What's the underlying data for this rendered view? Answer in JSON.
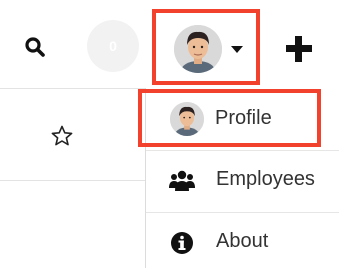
{
  "header": {
    "search_icon": "search-icon",
    "notification_count": "0",
    "user_menu_icon": "user-avatar",
    "caret_icon": "caret-down-icon",
    "create_icon": "plus-icon"
  },
  "list": {
    "favorite_icon": "star-icon"
  },
  "user_menu": {
    "items": [
      {
        "label": "Profile",
        "icon": "user-avatar",
        "highlighted": true
      },
      {
        "label": "Employees",
        "icon": "users-icon"
      },
      {
        "label": "About",
        "icon": "info-icon"
      }
    ]
  },
  "colors": {
    "highlight": "#f2412c",
    "badge_bg": "#f2f2f2",
    "icon": "#111111",
    "text": "#333333"
  }
}
